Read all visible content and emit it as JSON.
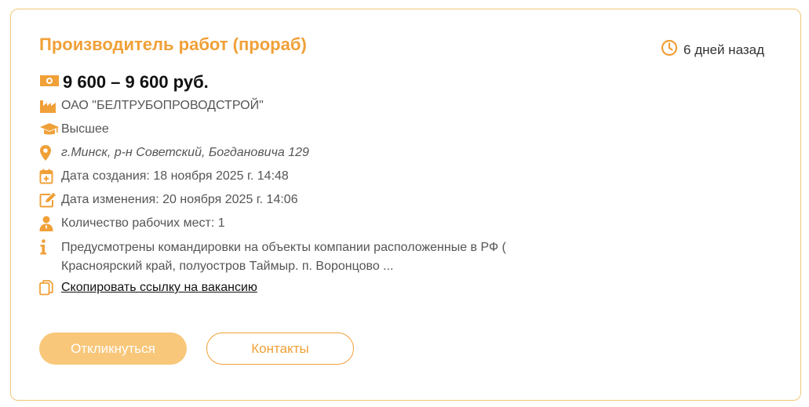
{
  "vacancy": {
    "title": "Производитель работ (прораб)",
    "posted_ago": "6 дней назад",
    "salary": "9 600 – 9 600 руб.",
    "company": "ОАО \"БЕЛТРУБОПРОВОДСТРОЙ\"",
    "education": "Высшее",
    "address": "г.Минск, р-н Советский, Богдановича 129",
    "created": "Дата создания: 18 ноября 2025 г. 14:48",
    "modified": "Дата изменения: 20 ноября 2025 г. 14:06",
    "workplaces": "Количество рабочих мест: 1",
    "description": "Предусмотрены командировки на объекты компании расположенные в РФ ( Красноярский край, полуостров Таймыр. п. Воронцово ...",
    "copy_link": "Скопировать ссылку на вакансию"
  },
  "buttons": {
    "apply": "Откликнуться",
    "contacts": "Контакты"
  },
  "colors": {
    "accent": "#f0a038",
    "apply_bg": "#f8c77a",
    "border": "#f0c878"
  },
  "icons": [
    "clock-icon",
    "money-icon",
    "factory-icon",
    "graduation-cap-icon",
    "map-pin-icon",
    "calendar-plus-icon",
    "edit-icon",
    "person-icon",
    "info-icon",
    "copy-icon"
  ]
}
